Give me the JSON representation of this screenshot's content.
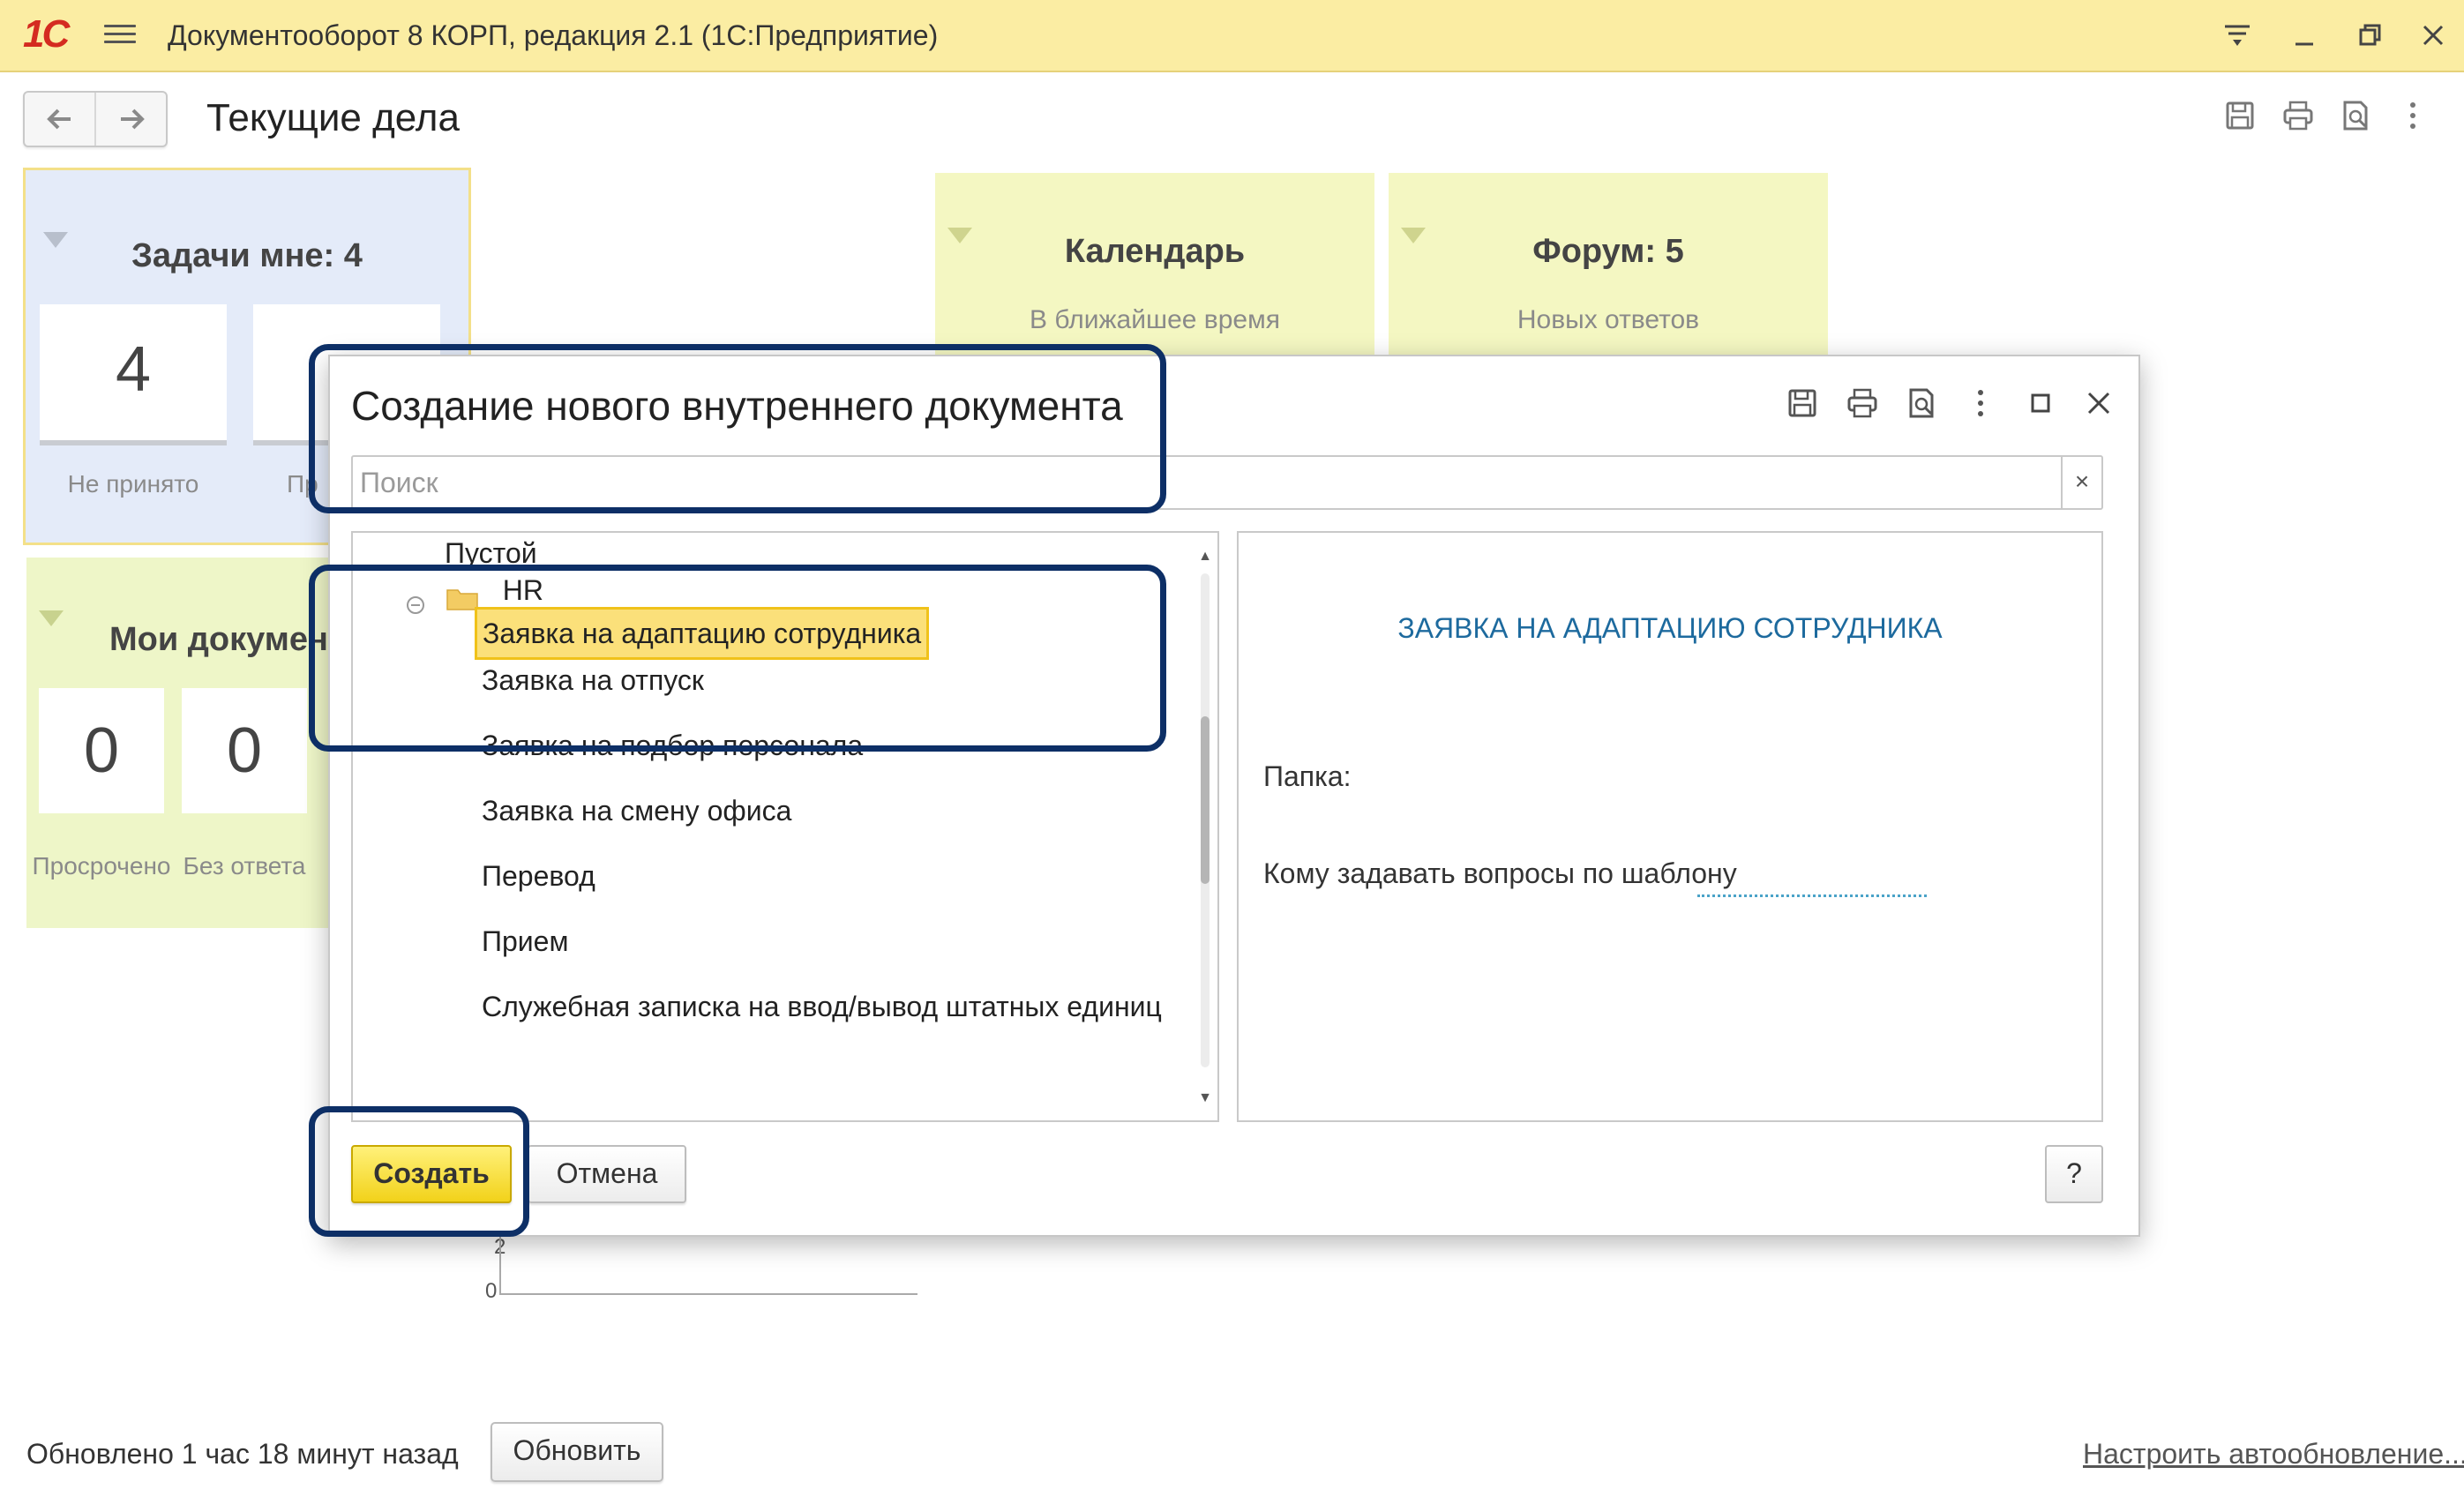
{
  "titlebar": {
    "logo_text": "1С",
    "title": "Документооборот 8 КОРП, редакция 2.1  (1С:Предприятие)",
    "controls": [
      "filter-icon",
      "minimize-icon",
      "restore-icon",
      "close-icon"
    ]
  },
  "page": {
    "title": "Текущие дела"
  },
  "panels": {
    "tasks": {
      "title": "Задачи мне: 4",
      "tiles": [
        {
          "value": "4",
          "caption": "Не принято"
        },
        {
          "value": "",
          "caption": "Пр"
        }
      ]
    },
    "docs": {
      "title": "Мои докумен",
      "tiles": [
        {
          "value": "0",
          "caption": "Просрочено"
        },
        {
          "value": "0",
          "caption": "Без ответа"
        }
      ]
    },
    "calendar": {
      "title": "Календарь",
      "subtitle": "В ближайшее время"
    },
    "forum": {
      "title": "Форум: 5",
      "subtitle": "Новых ответов"
    }
  },
  "chart_remnant": {
    "tick_labels": [
      "2",
      "0"
    ]
  },
  "footer": {
    "updated_text": "Обновлено 1 час 18 минут назад",
    "refresh_label": "Обновить",
    "auto_link": "Настроить автообновление..."
  },
  "dialog": {
    "title": "Создание нового внутреннего документа",
    "search_placeholder": "Поиск",
    "search_clear": "×",
    "tree": {
      "items": [
        {
          "label": "Пустой",
          "level": 1
        },
        {
          "label": "HR",
          "level": 0,
          "type": "folder",
          "expanded": true
        },
        {
          "label": "Заявка на адаптацию сотрудника",
          "level": 1,
          "selected": true
        },
        {
          "label": "Заявка на отпуск",
          "level": 1
        },
        {
          "label": "Заявка на подбор персонала",
          "level": 1
        },
        {
          "label": "Заявка на смену офиса",
          "level": 1
        },
        {
          "label": "Перевод",
          "level": 1
        },
        {
          "label": "Прием",
          "level": 1
        },
        {
          "label": "Служебная записка на ввод/вывод штатных единиц",
          "level": 1
        }
      ]
    },
    "preview": {
      "title": "ЗАЯВКА НА АДАПТАЦИЮ СОТРУДНИКА",
      "folder_label": "Папка:",
      "questions_label": "Кому задавать вопросы по шаблону"
    },
    "buttons": {
      "create": "Создать",
      "cancel": "Отмена",
      "help": "?"
    }
  },
  "colors": {
    "titlebar_bg": "#fbeda3",
    "accent_yellow": "#f2d21a",
    "highlight_border": "#0d2f66",
    "link_blue": "#1d6a9e",
    "panel_blue": "#e4ebf9",
    "panel_green": "#eef6c8"
  }
}
